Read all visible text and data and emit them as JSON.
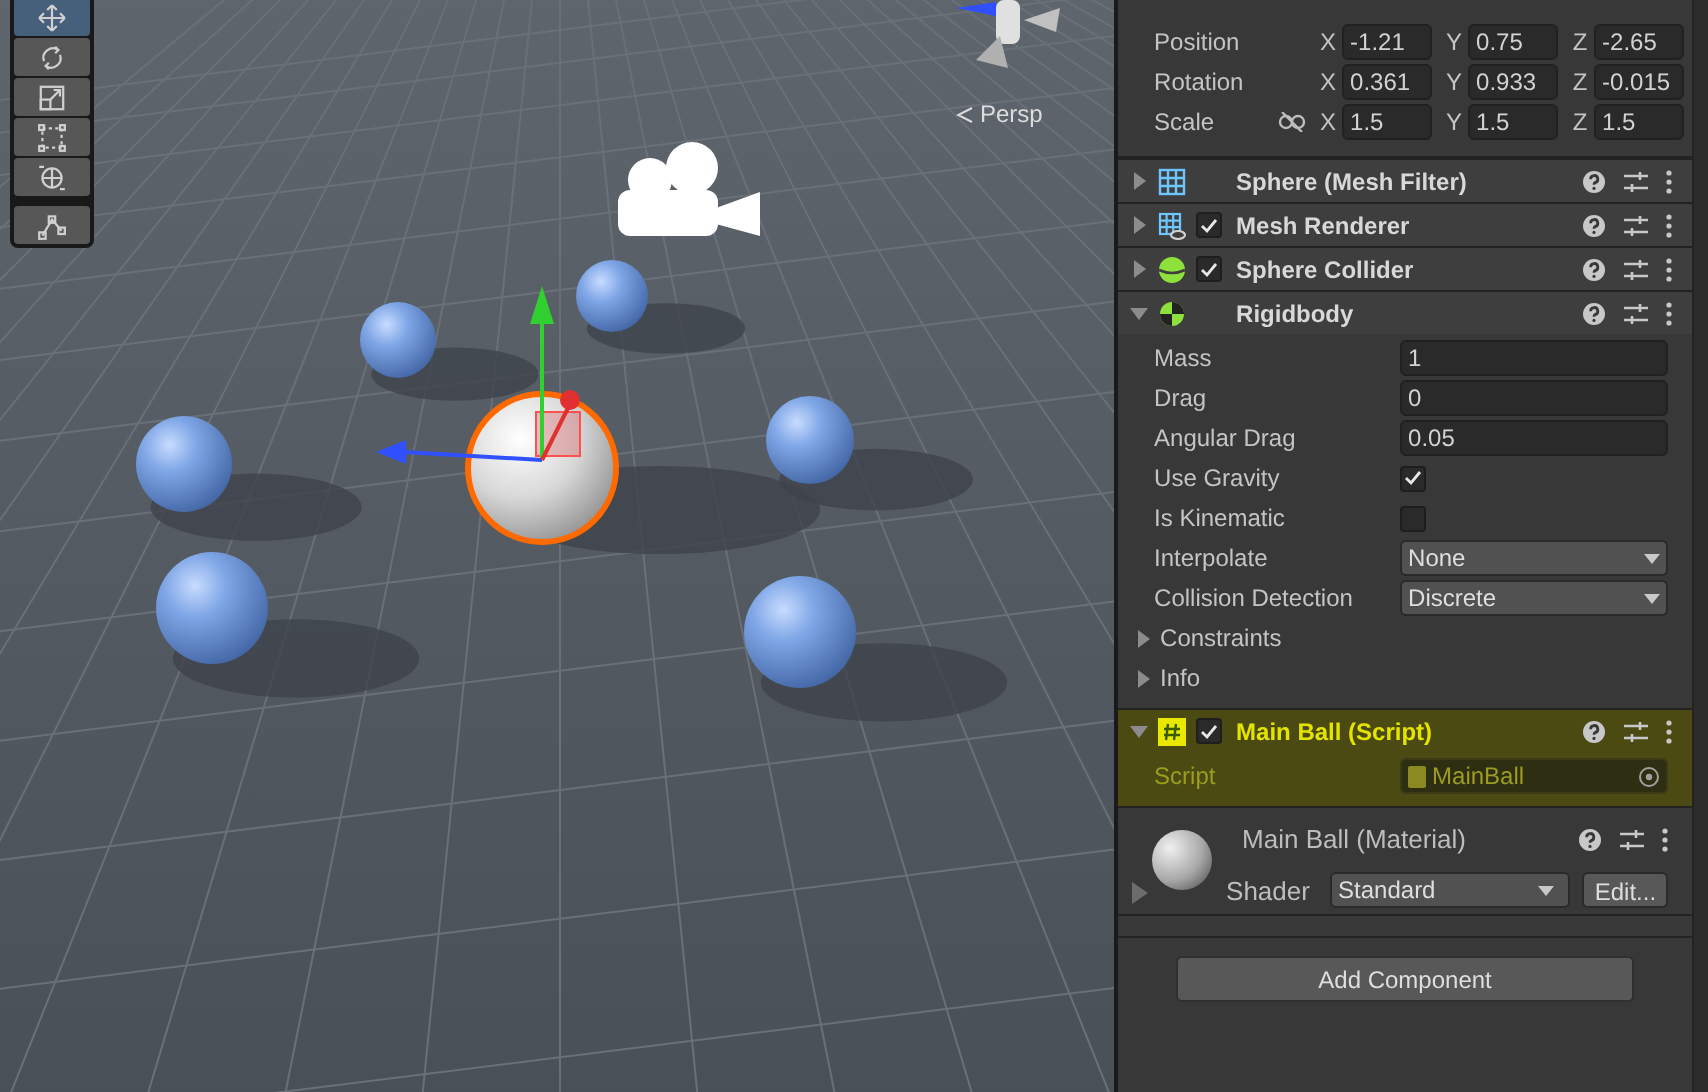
{
  "scene_view": {
    "tools": [
      {
        "kind": "move",
        "selected": true
      },
      {
        "kind": "rotate",
        "selected": false
      },
      {
        "kind": "scale",
        "selected": false
      },
      {
        "kind": "rect",
        "selected": false
      },
      {
        "kind": "transform",
        "selected": false
      },
      {
        "kind": "custom",
        "selected": false
      }
    ],
    "projection_label": "Persp"
  },
  "inspector": {
    "transform": {
      "rows": [
        {
          "kind": "vector",
          "label": "Position",
          "fields": [
            {
              "axis": "X",
              "value": "-1.21"
            },
            {
              "axis": "Y",
              "value": "0.75"
            },
            {
              "axis": "Z",
              "value": "-2.65"
            }
          ]
        },
        {
          "kind": "vector",
          "label": "Rotation",
          "fields": [
            {
              "axis": "X",
              "value": "0.361"
            },
            {
              "axis": "Y",
              "value": "0.933"
            },
            {
              "axis": "Z",
              "value": "-0.015"
            }
          ]
        },
        {
          "kind": "vector_constrain",
          "label": "Scale",
          "fields": [
            {
              "axis": "X",
              "value": "1.5"
            },
            {
              "axis": "Y",
              "value": "1.5"
            },
            {
              "axis": "Z",
              "value": "1.5"
            }
          ]
        }
      ]
    },
    "components": [
      {
        "kind": "mesh_filter",
        "title": "Sphere (Mesh Filter)",
        "expanded": false,
        "highlighted": false
      },
      {
        "kind": "mesh_renderer",
        "title": "Mesh Renderer",
        "enabled": true,
        "expanded": false,
        "highlighted": false
      },
      {
        "kind": "sphere_collider",
        "title": "Sphere Collider",
        "enabled": true,
        "expanded": false,
        "highlighted": false
      },
      {
        "kind": "rigidbody",
        "title": "Rigidbody",
        "expanded": true,
        "highlighted": false,
        "properties": [
          {
            "kind": "field",
            "label": "Mass",
            "value": "1"
          },
          {
            "kind": "field",
            "label": "Drag",
            "value": "0"
          },
          {
            "kind": "field",
            "label": "Angular Drag",
            "value": "0.05"
          },
          {
            "kind": "toggle",
            "label": "Use Gravity",
            "checked": true
          },
          {
            "kind": "toggle",
            "label": "Is Kinematic",
            "checked": false
          },
          {
            "kind": "dropdown",
            "label": "Interpolate",
            "value": "None"
          },
          {
            "kind": "dropdown",
            "label": "Collision Detection",
            "value": "Discrete"
          },
          {
            "kind": "foldout",
            "label": "Constraints",
            "expanded": false
          },
          {
            "kind": "foldout",
            "label": "Info",
            "expanded": false
          }
        ]
      },
      {
        "kind": "script",
        "title": "Main Ball (Script)",
        "enabled": true,
        "expanded": true,
        "highlighted": true,
        "properties": [
          {
            "kind": "object",
            "label": "Script",
            "value": "MainBall"
          }
        ]
      }
    ],
    "material": {
      "title": "Main Ball (Material)",
      "shader_label": "Shader",
      "shader": "Standard",
      "edit_button": "Edit...",
      "expanded": false
    },
    "add_component": "Add Component"
  }
}
